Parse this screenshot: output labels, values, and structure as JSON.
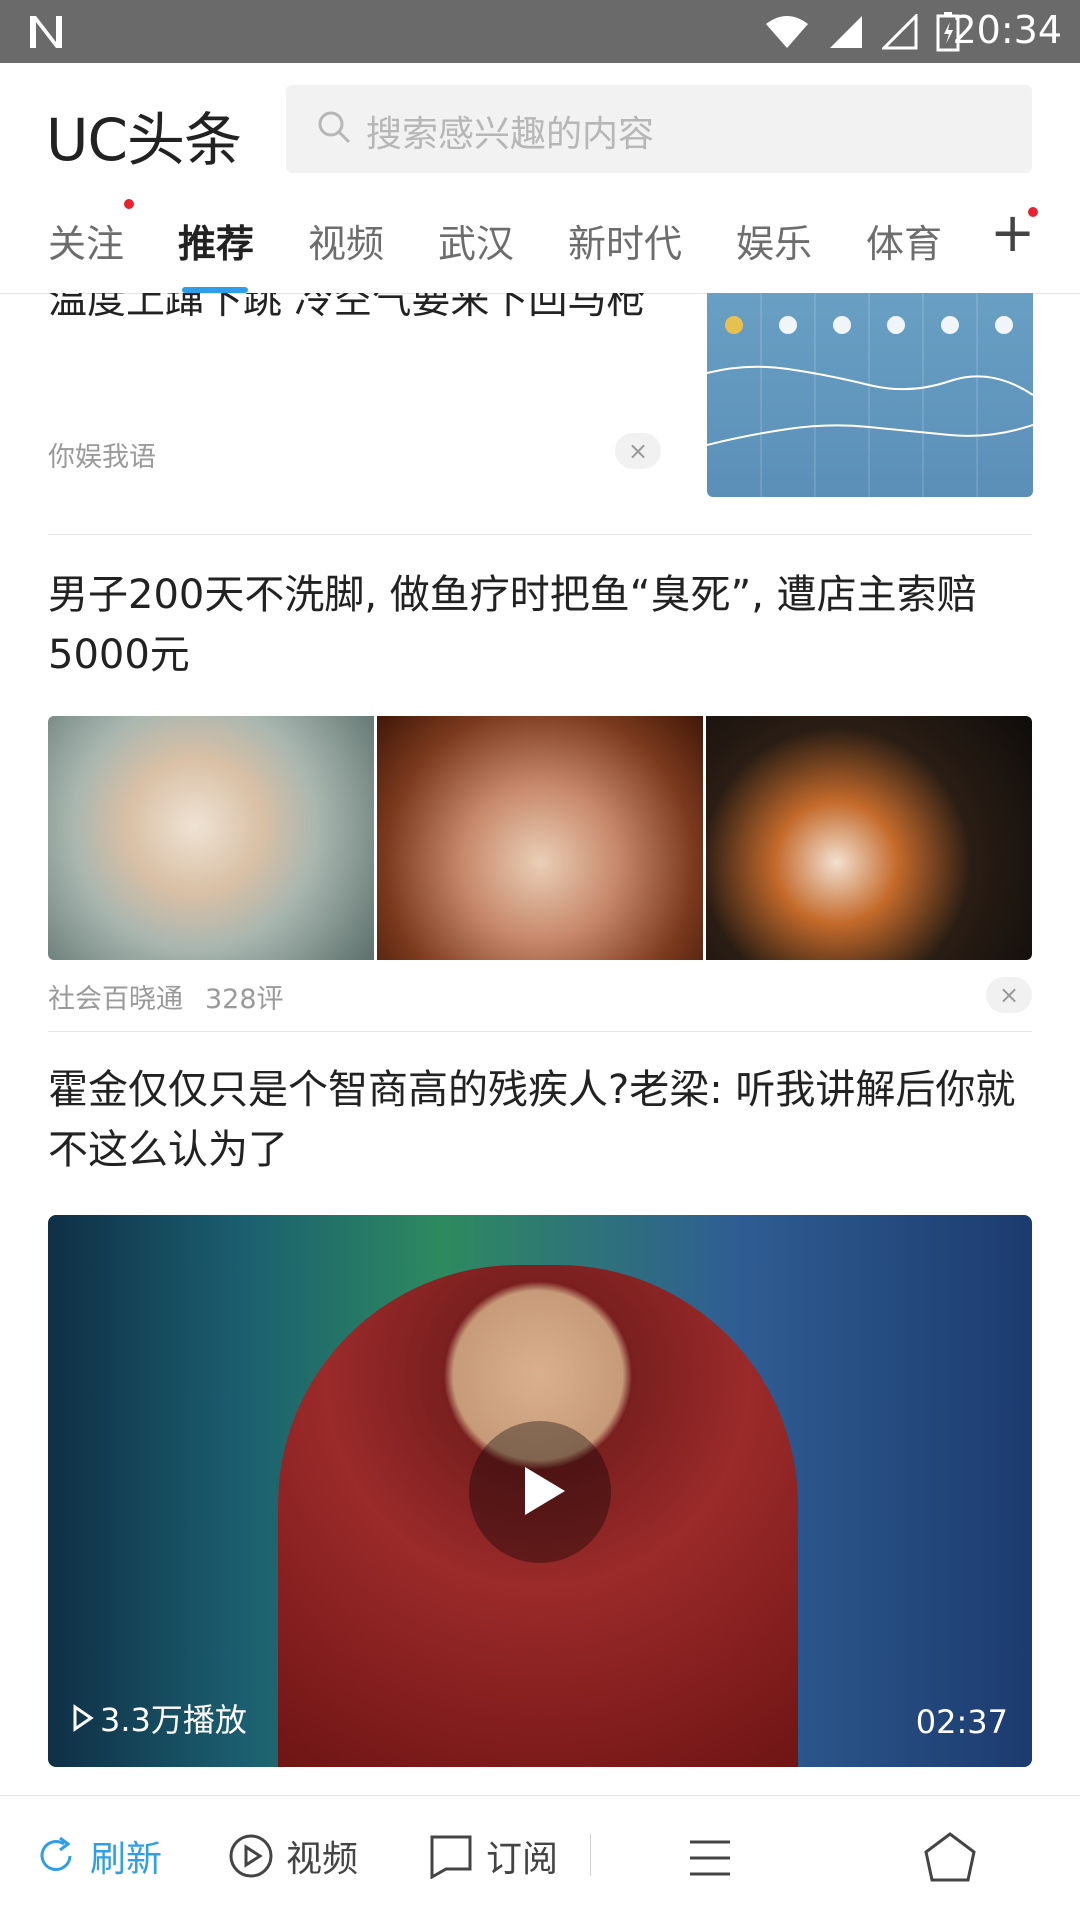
{
  "status_bar": {
    "time": "20:34",
    "icons": [
      "n-logo-icon",
      "wifi-icon",
      "signal-icon",
      "signal-empty-icon",
      "battery-charging-icon"
    ]
  },
  "header": {
    "brand": "UC头条",
    "search_placeholder": "搜索感兴趣的内容"
  },
  "tabs": [
    {
      "label": "关注",
      "has_dot": true,
      "active": false
    },
    {
      "label": "推荐",
      "has_dot": false,
      "active": true
    },
    {
      "label": "视频",
      "has_dot": false,
      "active": false
    },
    {
      "label": "武汉",
      "has_dot": false,
      "active": false
    },
    {
      "label": "新时代",
      "has_dot": false,
      "active": false
    },
    {
      "label": "娱乐",
      "has_dot": false,
      "active": false
    },
    {
      "label": "体育",
      "has_dot": false,
      "active": false
    }
  ],
  "tab_add_label": "+",
  "feed": [
    {
      "title_partial": "温度上蹿下跳 冷空气要来下回马枪",
      "source": "你娱我语",
      "close": "×"
    },
    {
      "title": "男子200天不洗脚, 做鱼疗时把鱼“臭死”, 遭店主索赔5000元",
      "source": "社会百晓通",
      "comments": "328评",
      "close": "×"
    },
    {
      "title": "霍金仅仅只是个智商高的残疾人?老梁: 听我讲解后你就不这么认为了",
      "video": {
        "plays": "3.3万播放",
        "duration": "02:37"
      }
    }
  ],
  "bottom_bar": {
    "refresh": "刷新",
    "video": "视频",
    "subscribe": "订阅"
  },
  "colors": {
    "accent": "#2e9ee8",
    "dot": "#e8232f",
    "status_bar": "#6a6a6a"
  }
}
